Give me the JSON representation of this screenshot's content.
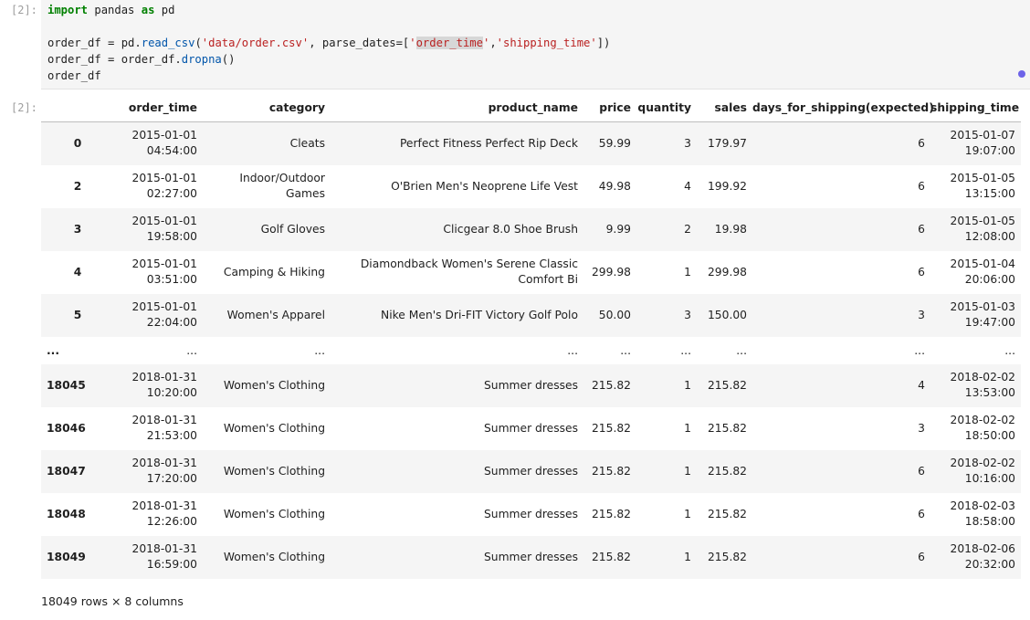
{
  "input_cell": {
    "prompt": "[2]:",
    "lines": [
      "import pandas as pd",
      "",
      "order_df = pd.read_csv('data/order.csv', parse_dates=['order_time','shipping_time'])",
      "order_df = order_df.dropna()",
      "order_df"
    ]
  },
  "output_cell": {
    "prompt": "[2]:",
    "columns": [
      "order_time",
      "category",
      "product_name",
      "price",
      "quantity",
      "sales",
      "days_for_shipping(expected)",
      "shipping_time"
    ],
    "rows": [
      {
        "index": "0",
        "order_time": [
          "2015-01-01",
          "04:54:00"
        ],
        "category": "Cleats",
        "product_name": "Perfect Fitness Perfect Rip Deck",
        "price": "59.99",
        "quantity": "3",
        "sales": "179.97",
        "days": "6",
        "shipping_time": [
          "2015-01-07",
          "19:07:00"
        ]
      },
      {
        "index": "2",
        "order_time": [
          "2015-01-01",
          "02:27:00"
        ],
        "category": [
          "Indoor/Outdoor",
          "Games"
        ],
        "product_name": "O'Brien Men's Neoprene Life Vest",
        "price": "49.98",
        "quantity": "4",
        "sales": "199.92",
        "days": "6",
        "shipping_time": [
          "2015-01-05",
          "13:15:00"
        ]
      },
      {
        "index": "3",
        "order_time": [
          "2015-01-01",
          "19:58:00"
        ],
        "category": "Golf Gloves",
        "product_name": "Clicgear 8.0 Shoe Brush",
        "price": "9.99",
        "quantity": "2",
        "sales": "19.98",
        "days": "6",
        "shipping_time": [
          "2015-01-05",
          "12:08:00"
        ]
      },
      {
        "index": "4",
        "order_time": [
          "2015-01-01",
          "03:51:00"
        ],
        "category": "Camping & Hiking",
        "product_name": [
          "Diamondback Women's Serene Classic",
          "Comfort Bi"
        ],
        "price": "299.98",
        "quantity": "1",
        "sales": "299.98",
        "days": "6",
        "shipping_time": [
          "2015-01-04",
          "20:06:00"
        ]
      },
      {
        "index": "5",
        "order_time": [
          "2015-01-01",
          "22:04:00"
        ],
        "category": "Women's Apparel",
        "product_name": "Nike Men's Dri-FIT Victory Golf Polo",
        "price": "50.00",
        "quantity": "3",
        "sales": "150.00",
        "days": "3",
        "shipping_time": [
          "2015-01-03",
          "19:47:00"
        ]
      },
      {
        "index": "...",
        "order_time": "...",
        "category": "...",
        "product_name": "...",
        "price": "...",
        "quantity": "...",
        "sales": "...",
        "days": "...",
        "shipping_time": "..."
      },
      {
        "index": "18045",
        "order_time": [
          "2018-01-31",
          "10:20:00"
        ],
        "category": "Women's Clothing",
        "product_name": "Summer dresses",
        "price": "215.82",
        "quantity": "1",
        "sales": "215.82",
        "days": "4",
        "shipping_time": [
          "2018-02-02",
          "13:53:00"
        ]
      },
      {
        "index": "18046",
        "order_time": [
          "2018-01-31",
          "21:53:00"
        ],
        "category": "Women's Clothing",
        "product_name": "Summer dresses",
        "price": "215.82",
        "quantity": "1",
        "sales": "215.82",
        "days": "3",
        "shipping_time": [
          "2018-02-02",
          "18:50:00"
        ]
      },
      {
        "index": "18047",
        "order_time": [
          "2018-01-31",
          "17:20:00"
        ],
        "category": "Women's Clothing",
        "product_name": "Summer dresses",
        "price": "215.82",
        "quantity": "1",
        "sales": "215.82",
        "days": "6",
        "shipping_time": [
          "2018-02-02",
          "10:16:00"
        ]
      },
      {
        "index": "18048",
        "order_time": [
          "2018-01-31",
          "12:26:00"
        ],
        "category": "Women's Clothing",
        "product_name": "Summer dresses",
        "price": "215.82",
        "quantity": "1",
        "sales": "215.82",
        "days": "6",
        "shipping_time": [
          "2018-02-03",
          "18:58:00"
        ]
      },
      {
        "index": "18049",
        "order_time": [
          "2018-01-31",
          "16:59:00"
        ],
        "category": "Women's Clothing",
        "product_name": "Summer dresses",
        "price": "215.82",
        "quantity": "1",
        "sales": "215.82",
        "days": "6",
        "shipping_time": [
          "2018-02-06",
          "20:32:00"
        ]
      }
    ],
    "shape": "18049 rows × 8 columns"
  },
  "colors": {
    "code_background": "#f5f5f5",
    "keyword": "#008000",
    "string": "#ba2121",
    "function": "#0055aa",
    "status_dot": "#6d63e8"
  }
}
